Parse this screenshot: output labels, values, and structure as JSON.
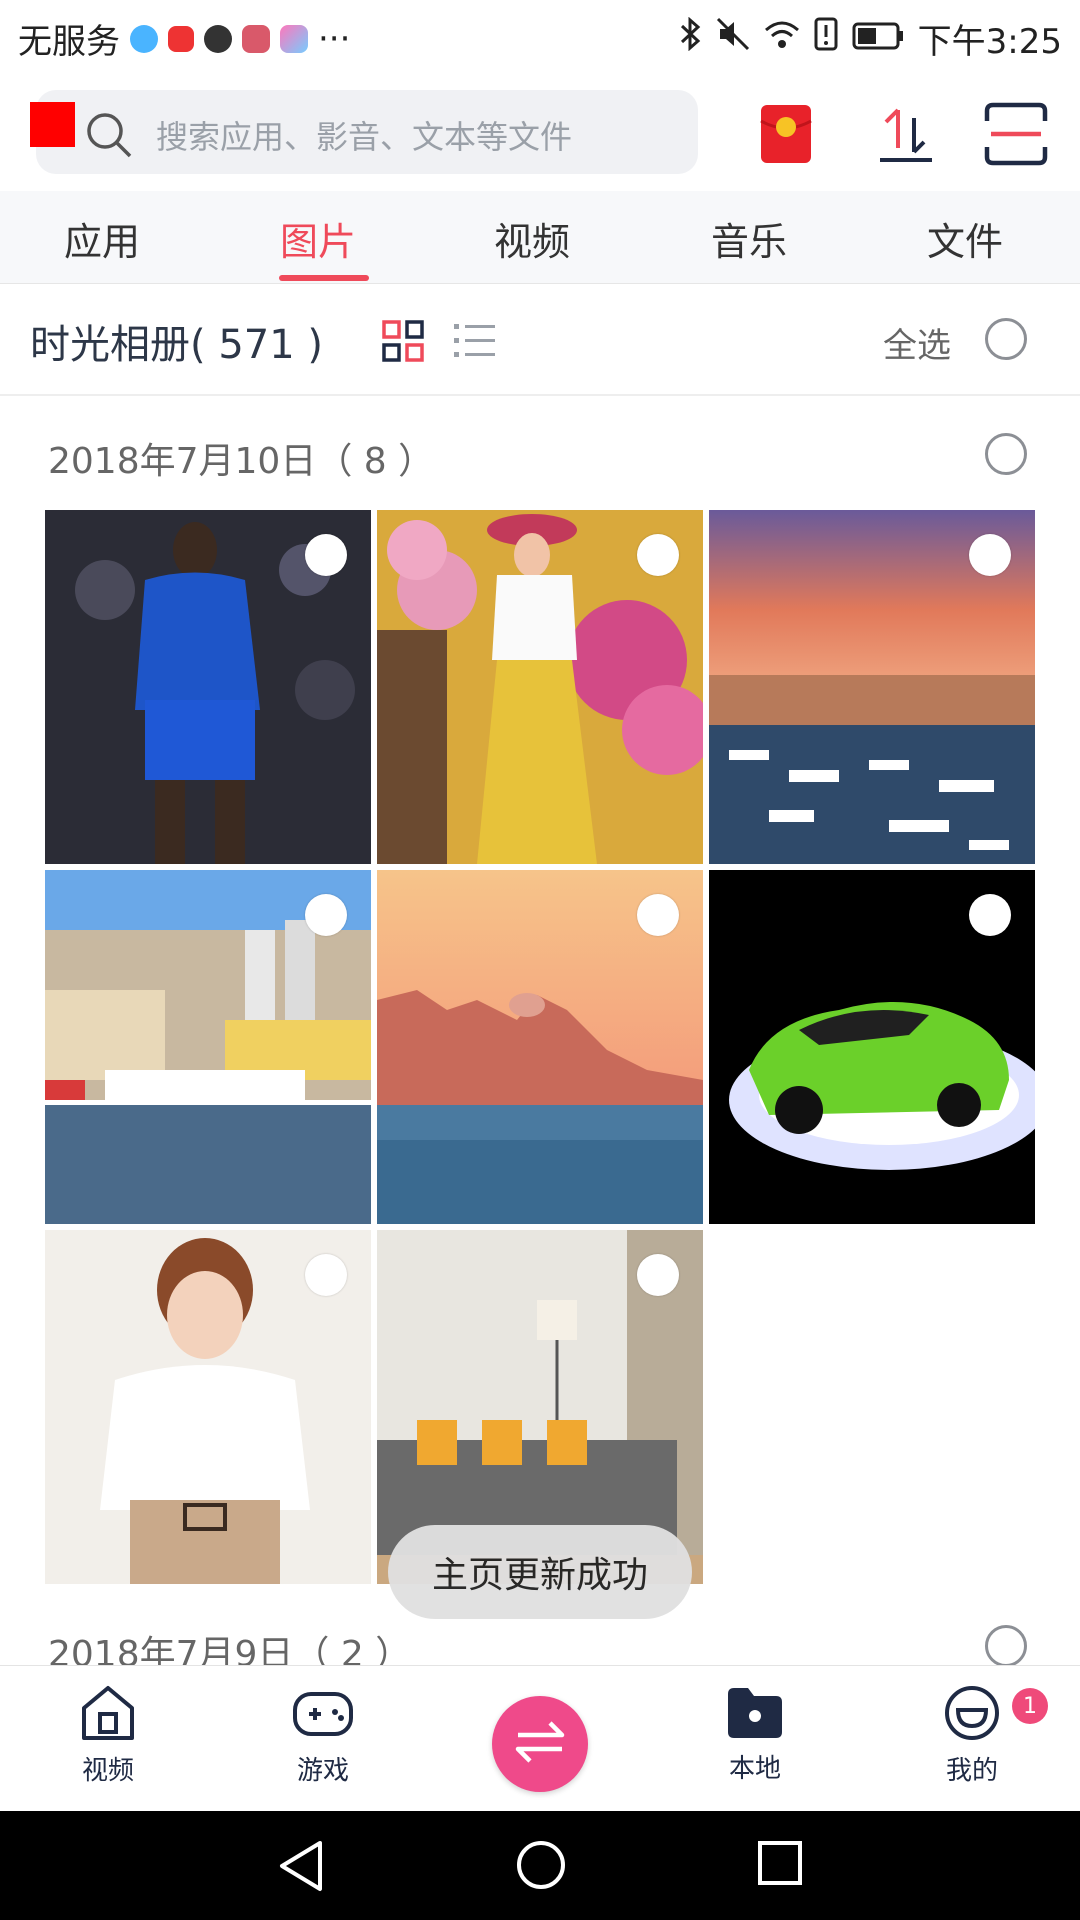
{
  "status_bar": {
    "carrier": "无服务",
    "more": "···",
    "time": "下午3:25"
  },
  "search": {
    "placeholder": "搜索应用、影音、文本等文件"
  },
  "tabs": [
    {
      "label": "应用"
    },
    {
      "label": "图片"
    },
    {
      "label": "视频"
    },
    {
      "label": "音乐"
    },
    {
      "label": "文件"
    }
  ],
  "album": {
    "title": "时光相册( 571 )",
    "select_all": "全选"
  },
  "groups": [
    {
      "date": "2018年7月10日（ 8 ）"
    },
    {
      "date": "2018年7月9日（ 2 ）"
    }
  ],
  "toast": {
    "message": "主页更新成功"
  },
  "bottom_nav": [
    {
      "label": "视频",
      "icon": "home-icon"
    },
    {
      "label": "游戏",
      "icon": "gamepad-icon"
    },
    {
      "label": "",
      "icon": "transfer-icon"
    },
    {
      "label": "本地",
      "icon": "folder-icon"
    },
    {
      "label": "我的",
      "icon": "smiley-icon"
    }
  ],
  "badge_count": "1",
  "colors": {
    "accent": "#ef4a5a",
    "nav_center": "#ef4a8a",
    "nav_text": "#1f2a44"
  }
}
